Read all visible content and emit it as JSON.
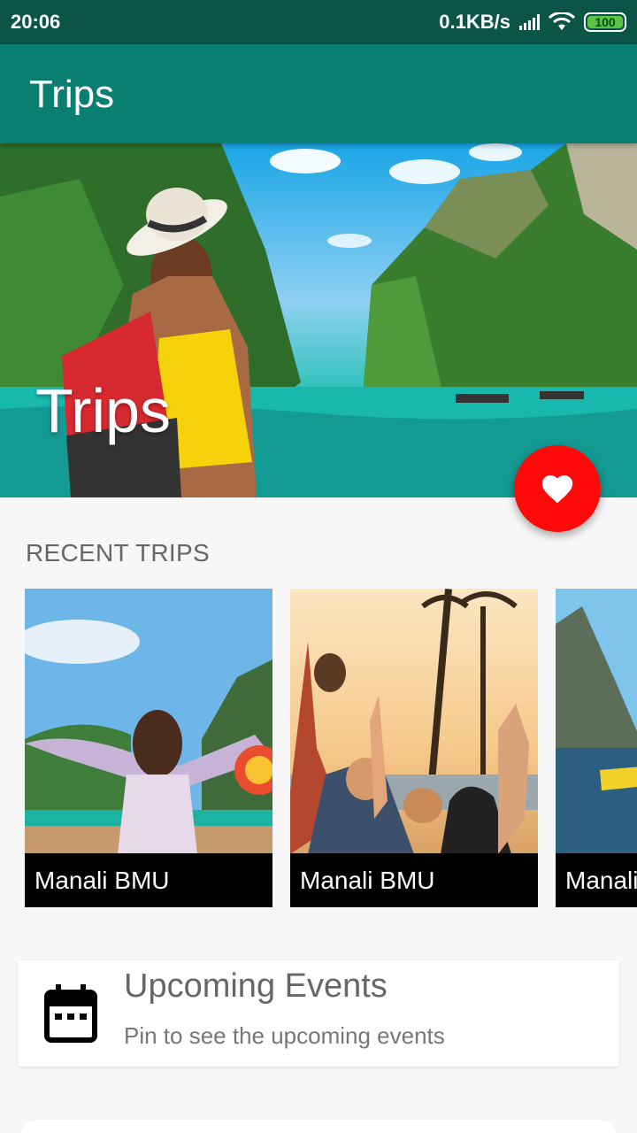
{
  "status_bar": {
    "time": "20:06",
    "network_speed": "0.1KB/s",
    "battery_level": "100",
    "icons": [
      "signal-icon",
      "wifi-icon",
      "battery-icon"
    ]
  },
  "app_bar": {
    "title": "Trips"
  },
  "hero": {
    "title": "Trips",
    "image": "woman-traveler-lagoon-photo"
  },
  "fab": {
    "icon": "heart-icon",
    "color": "#ff0a0a"
  },
  "recent_trips": {
    "heading": "RECENT TRIPS",
    "items": [
      {
        "name": "Manali BMU",
        "image": "beach-boat-photo"
      },
      {
        "name": "Manali BMU",
        "image": "party-crowd-photo"
      },
      {
        "name": "Manali BMU",
        "image": "fjord-kayak-photo"
      }
    ]
  },
  "events": {
    "icon": "calendar-icon",
    "title": "Upcoming Events",
    "subtitle": "Pin to see the upcoming events"
  },
  "colors": {
    "primary": "#087f70",
    "primary_dark": "#0a5548",
    "accent": "#ff0a0a"
  }
}
